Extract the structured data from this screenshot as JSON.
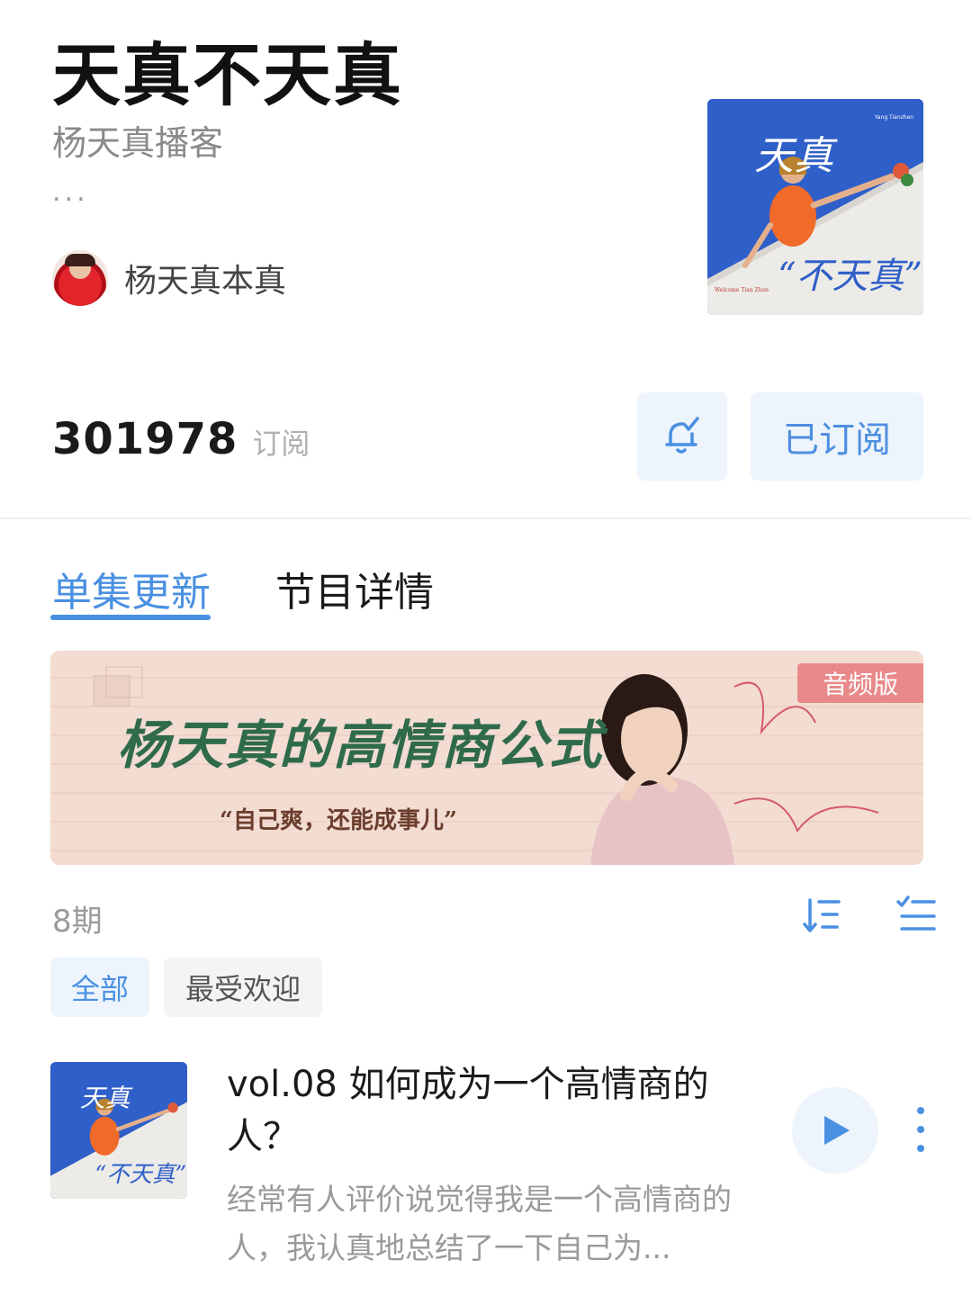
{
  "podcast": {
    "title": "天真不天真",
    "subtitle": "杨天真播客",
    "ellipsis": "...",
    "author": "杨天真本真",
    "cover_text": {
      "top": "天真",
      "bottom": "“不天真”",
      "welcome": "Welcome Tian Zhen",
      "brand": "Yang Tianzhen"
    }
  },
  "stats": {
    "subscribers": "301978",
    "subscribers_label": "订阅"
  },
  "actions": {
    "subscribed_label": "已订阅"
  },
  "tabs": [
    {
      "label": "单集更新",
      "active": true
    },
    {
      "label": "节目详情",
      "active": false
    }
  ],
  "banner": {
    "title": "杨天真的高情商公式",
    "quote": "“自己爽，还能成事儿”",
    "tag": "音频版",
    "script_text": "Yang Tian Zhen"
  },
  "episode_list": {
    "count": "8期",
    "filters": [
      {
        "label": "全部",
        "active": true
      },
      {
        "label": "最受欢迎",
        "active": false
      }
    ],
    "episodes": [
      {
        "title": "vol.08 如何成为一个高情商的人？",
        "description": "经常有人评价说觉得我是一个高情商的人，我认真地总结了一下自己为..."
      }
    ]
  },
  "colors": {
    "accent": "#4a90e2",
    "accent_bg": "#edf4fc",
    "cover_blue": "#2f5fc8",
    "banner_pink": "#f3dcd2",
    "banner_green": "#2f6b4a"
  },
  "icons": {
    "bell": "bell-check-icon",
    "sort": "sort-icon",
    "multiselect": "multiselect-icon",
    "play": "play-icon",
    "more": "more-vertical-icon"
  }
}
